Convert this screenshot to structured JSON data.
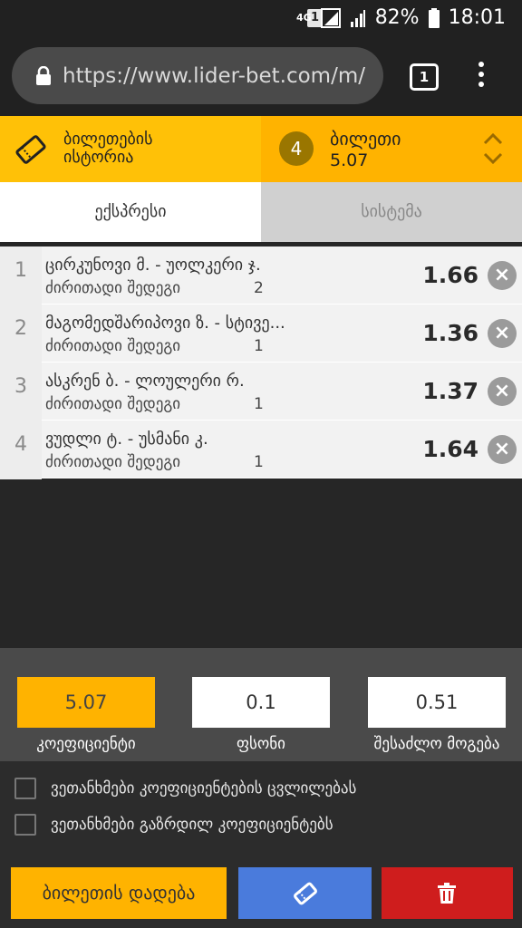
{
  "status_bar": {
    "sim_slot": "1",
    "network_type": "4G",
    "battery_percent": "82%",
    "time": "18:01"
  },
  "browser": {
    "url": "https://www.lider-bet.com/m/",
    "tab_count": "1",
    "menu_icon": "vertical-dots-icon"
  },
  "header": {
    "history_label_line1": "ბილეთების",
    "history_label_line2": "ისტორია",
    "ticket_count": "4",
    "ticket_title": "ბილეთი",
    "ticket_odds": "5.07",
    "colors": {
      "accent": "#ffb300",
      "history_bg": "#ffc107"
    }
  },
  "tabs": [
    {
      "label": "ექსპრესი",
      "active": true
    },
    {
      "label": "სისტემა",
      "active": false
    }
  ],
  "bets": [
    {
      "num": "1",
      "match": "ცირკუნოვი მ. - უოლკერი ჯ.",
      "market": "ძირითადი შედეგი",
      "outcome": "2",
      "odds": "1.66"
    },
    {
      "num": "2",
      "match": "მაგომედშარიპოვი ზ. - სტივე...",
      "market": "ძირითადი შედეგი",
      "outcome": "1",
      "odds": "1.36"
    },
    {
      "num": "3",
      "match": "ასკრენ ბ. - ლოულერი რ.",
      "market": "ძირითადი შედეგი",
      "outcome": "1",
      "odds": "1.37"
    },
    {
      "num": "4",
      "match": "ვუდლი ტ. - უსმანი კ.",
      "market": "ძირითადი შედეგი",
      "outcome": "1",
      "odds": "1.64"
    }
  ],
  "summary": {
    "coefficient": {
      "value": "5.07",
      "label": "კოეფიციენტი"
    },
    "stake": {
      "value": "0.1",
      "label": "ფსონი"
    },
    "possible_win": {
      "value": "0.51",
      "label": "შესაძლო მოგება"
    }
  },
  "options": [
    {
      "label": "ვეთანხმები კოეფიციენტების ცვლილებას",
      "checked": false
    },
    {
      "label": "ვეთანხმები გაზრდილ კოეფიციენტებს",
      "checked": false
    }
  ],
  "actions": {
    "place_bet_label": "ბილეთის დადება",
    "edit_icon": "ticket-icon",
    "delete_icon": "trash-icon",
    "colors": {
      "place": "#ffb300",
      "edit": "#4a7bdc",
      "delete": "#cf1d1d"
    }
  }
}
